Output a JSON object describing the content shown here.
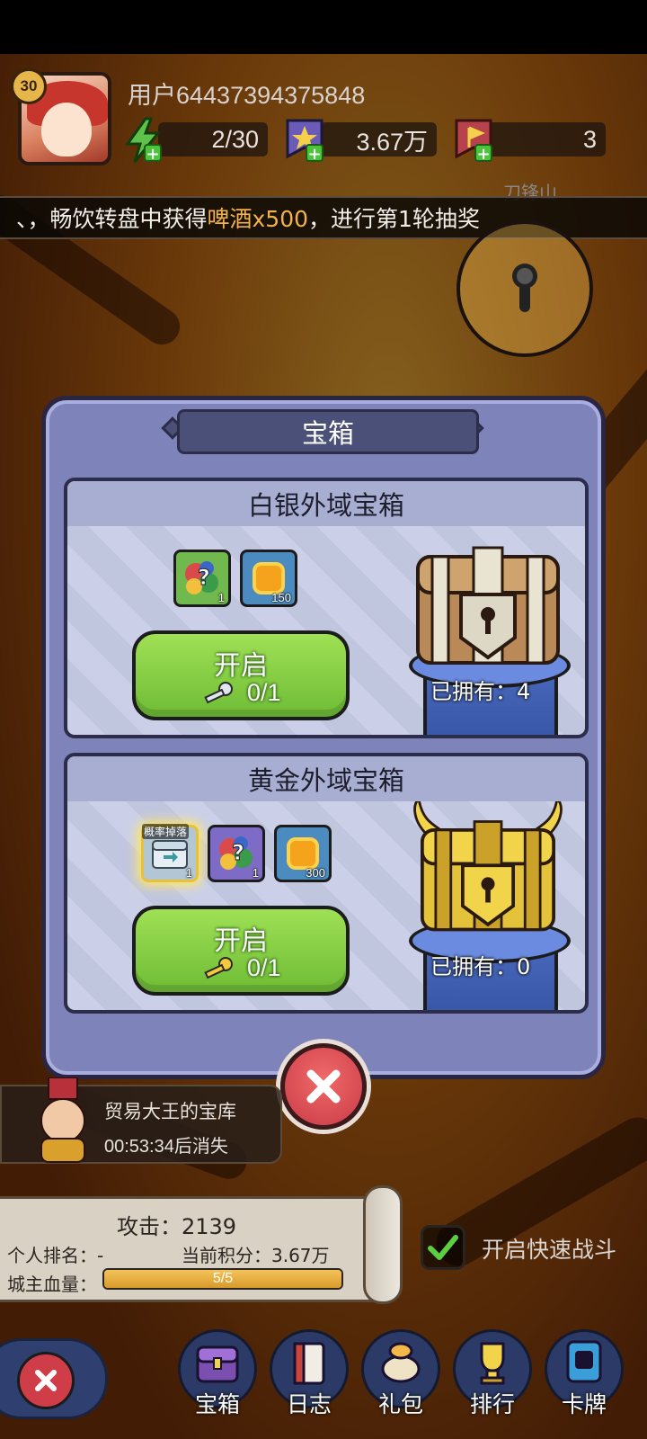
{
  "header": {
    "level": "30",
    "username": "用户64437394375848",
    "energy": "2/30",
    "points": "3.67万",
    "flags": "3",
    "location_label": "刀锋山"
  },
  "ticker": {
    "prefix": "、，畅饮转盘中获得",
    "highlight": "啤酒x500",
    "suffix": "，进行第1轮抽奖"
  },
  "modal": {
    "title": "宝箱",
    "silver": {
      "name": "白银外域宝箱",
      "items": [
        {
          "icon": "mystery-gems-icon",
          "count": "1"
        },
        {
          "icon": "gold-coin-icon",
          "count": "150"
        }
      ],
      "open_label": "开启",
      "key_count": "0/1",
      "owned": "已拥有：4"
    },
    "gold": {
      "name": "黄金外域宝箱",
      "drop_tag": "概率掉落",
      "items": [
        {
          "icon": "silver-chest-icon",
          "count": "1"
        },
        {
          "icon": "mystery-gems-icon",
          "count": "1"
        },
        {
          "icon": "gold-coin-icon",
          "count": "300"
        }
      ],
      "open_label": "开启",
      "key_count": "0/1",
      "owned": "已拥有：0"
    }
  },
  "event": {
    "title": "贸易大王的宝库",
    "timer": "00:53:34后消失"
  },
  "stats": {
    "attack": "攻击：2139",
    "rank": "个人排名：-",
    "score": "当前积分：3.67万",
    "hp_label": "城主血量：",
    "hp_text": "5/5",
    "hp_fraction": 1.0
  },
  "quick_battle": {
    "label": "开启快速战斗",
    "checked": true
  },
  "nav": [
    {
      "label": "宝箱",
      "icon": "chest-icon"
    },
    {
      "label": "日志",
      "icon": "log-icon"
    },
    {
      "label": "礼包",
      "icon": "gift-icon"
    },
    {
      "label": "排行",
      "icon": "trophy-icon"
    },
    {
      "label": "卡牌",
      "icon": "card-icon"
    }
  ],
  "colors": {
    "modal_bg": "#7e84b9",
    "button_green": "#6ebc35",
    "close_red": "#c93a45",
    "highlight": "#f2b24a"
  }
}
